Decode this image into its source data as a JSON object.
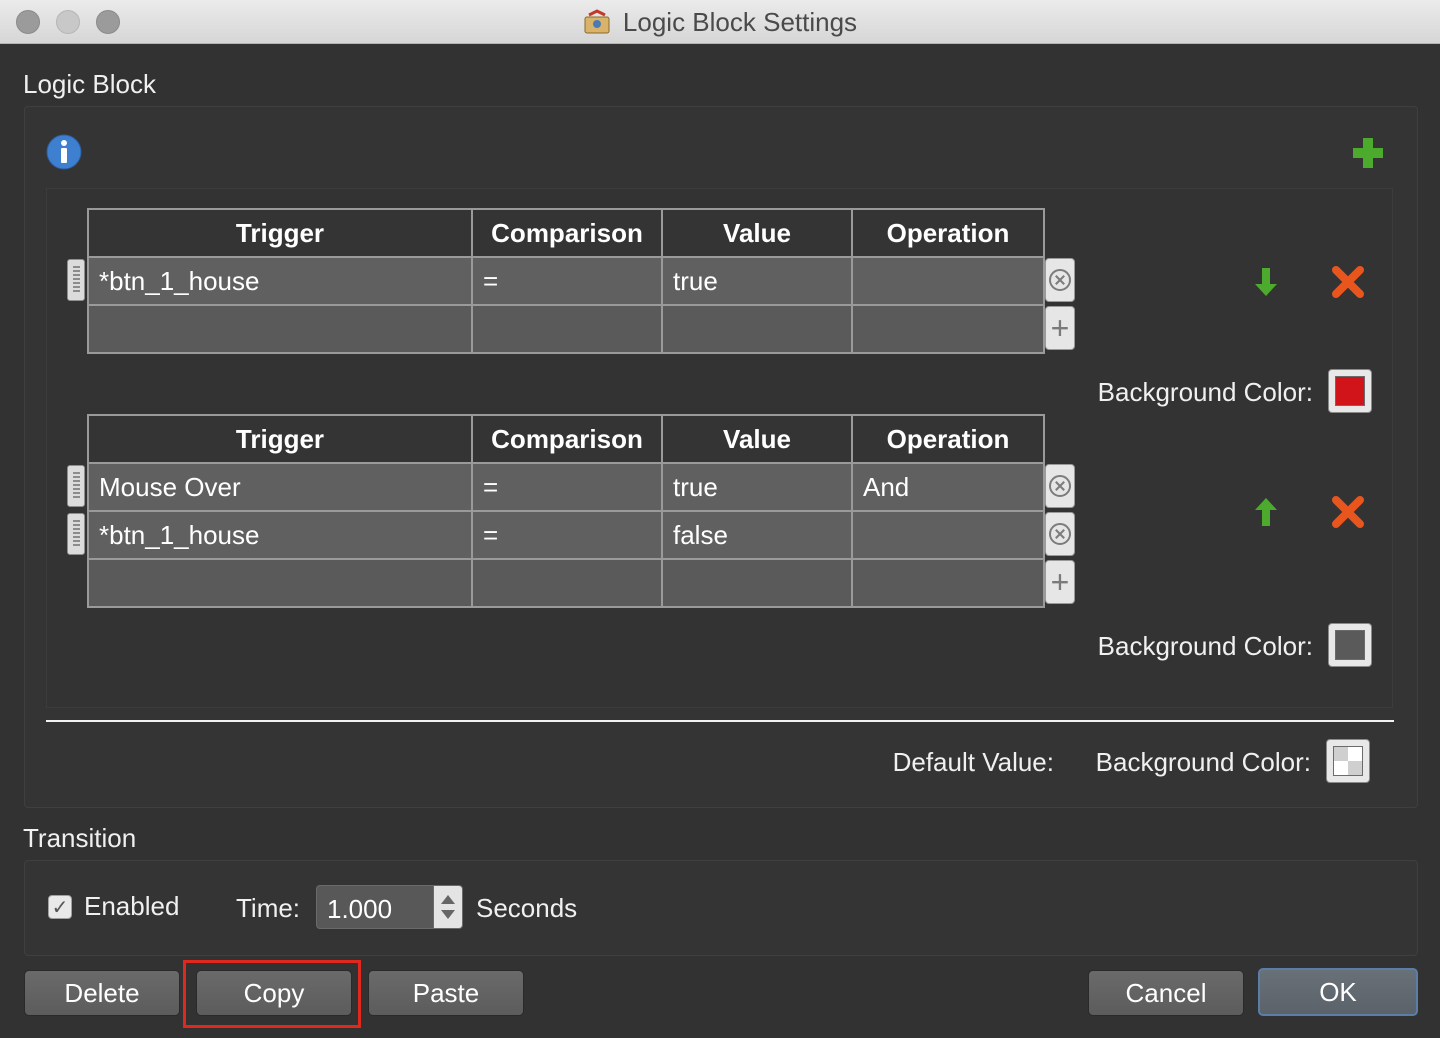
{
  "window": {
    "title": "Logic Block Settings"
  },
  "logic_block": {
    "label": "Logic Block",
    "tables": [
      {
        "headers": [
          "Trigger",
          "Comparison",
          "Value",
          "Operation"
        ],
        "rows": [
          [
            "*btn_1_house",
            "=",
            "true",
            ""
          ]
        ],
        "background_color_label": "Background Color:",
        "background_color": "#d0141a",
        "move_direction": "down"
      },
      {
        "headers": [
          "Trigger",
          "Comparison",
          "Value",
          "Operation"
        ],
        "rows": [
          [
            "Mouse Over",
            "=",
            "true",
            "And"
          ],
          [
            "*btn_1_house",
            "=",
            "false",
            ""
          ]
        ],
        "background_color_label": "Background Color:",
        "background_color": "#5a5a5a",
        "move_direction": "up"
      }
    ],
    "default_value_label": "Default Value:",
    "default_background_color_label": "Background Color:"
  },
  "transition": {
    "label": "Transition",
    "enabled_label": "Enabled",
    "enabled": true,
    "time_label": "Time:",
    "time_value": "1.000",
    "units_label": "Seconds"
  },
  "buttons": {
    "delete": "Delete",
    "copy": "Copy",
    "paste": "Paste",
    "cancel": "Cancel",
    "ok": "OK"
  },
  "colors": {
    "accent_add": "#4caa2c",
    "remove": "#e8561e",
    "highlight": "#e0281e"
  }
}
